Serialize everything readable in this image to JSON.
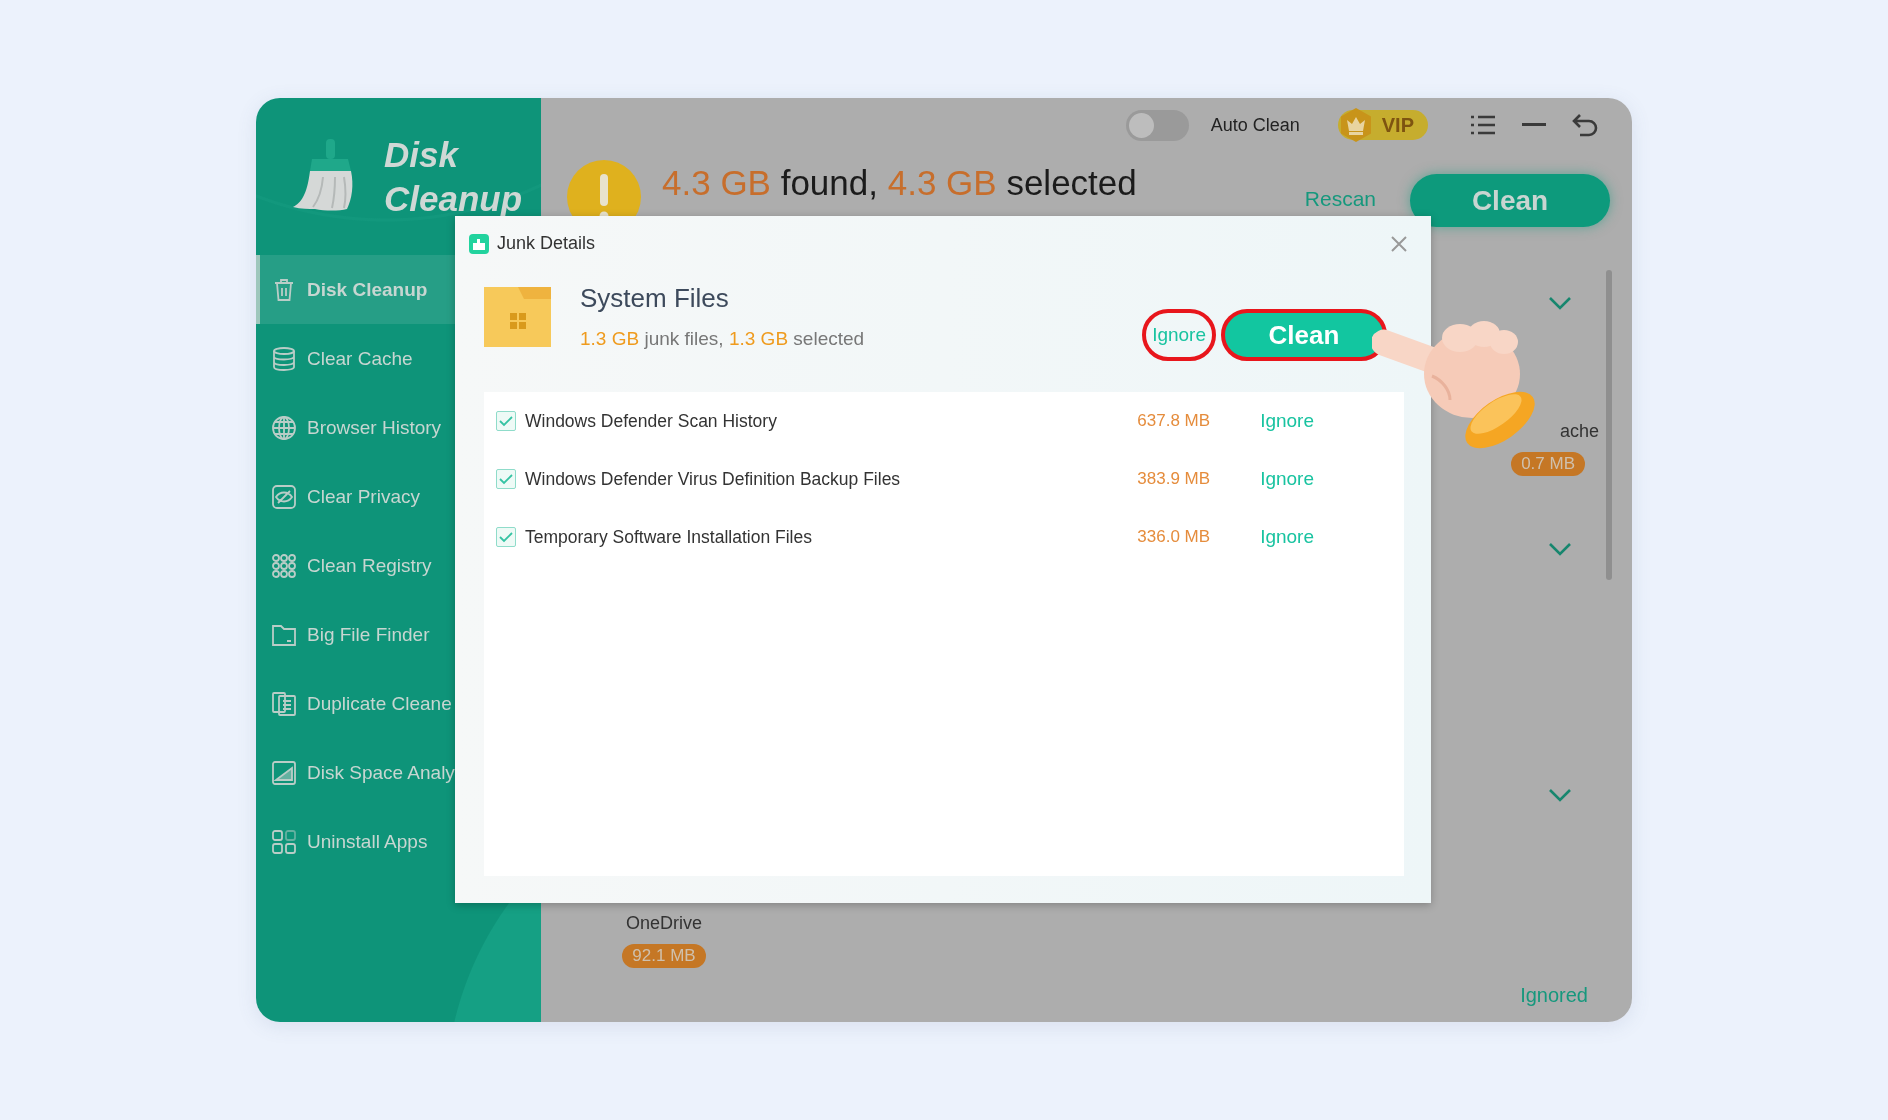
{
  "app": {
    "name_lines": [
      "Disk",
      "Cleanup"
    ]
  },
  "sidebar": {
    "items": [
      {
        "label": "Disk Cleanup",
        "selected": true
      },
      {
        "label": "Clear Cache",
        "selected": false
      },
      {
        "label": "Browser History",
        "selected": false
      },
      {
        "label": "Clear Privacy",
        "selected": false
      },
      {
        "label": "Clean Registry",
        "selected": false
      },
      {
        "label": "Big File Finder",
        "selected": false
      },
      {
        "label": "Duplicate Cleane",
        "selected": false
      },
      {
        "label": "Disk Space Analy",
        "selected": false
      },
      {
        "label": "Uninstall Apps",
        "selected": false
      }
    ]
  },
  "header": {
    "auto_clean": {
      "label": "Auto Clean",
      "on": false
    },
    "vip": "VIP",
    "summary": {
      "found_size": "4.3 GB",
      "found_label": "found,",
      "selected_size": "4.3 GB",
      "selected_label": "selected"
    },
    "rescan": "Rescan",
    "clean": "Clean"
  },
  "sections": [
    {
      "expanded": false,
      "items": [
        {
          "name": "ache",
          "size": "0.7 MB"
        }
      ]
    },
    {
      "expanded": false
    },
    {
      "expanded": false,
      "items": [
        {
          "name": "OneDrive",
          "size": "92.1 MB"
        }
      ]
    }
  ],
  "footer": {
    "ignored_link": "Ignored"
  },
  "dialog": {
    "title": "Junk Details",
    "category": "System Files",
    "junk_size": "1.3 GB",
    "junk_label": "junk files,",
    "selected_size": "1.3 GB",
    "selected_label": "selected",
    "ignore_button": {
      "label": "Ignore",
      "highlighted": true
    },
    "clean_button": {
      "label": "Clean",
      "highlighted": true
    },
    "rows": [
      {
        "name": "Windows Defender Scan History",
        "size": "637.8 MB",
        "checked": true,
        "action": "Ignore"
      },
      {
        "name": "Windows Defender Virus Definition Backup Files",
        "size": "383.9 MB",
        "checked": true,
        "action": "Ignore"
      },
      {
        "name": "Temporary Software Installation Files",
        "size": "336.0 MB",
        "checked": true,
        "action": "Ignore"
      }
    ]
  }
}
